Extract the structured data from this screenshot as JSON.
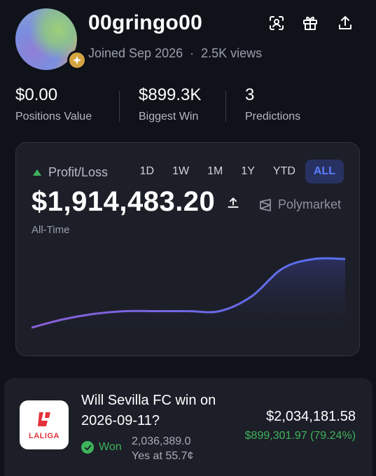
{
  "profile": {
    "username": "00gringo00",
    "joined": "Joined Sep 2026",
    "separator": "·",
    "views": "2.5K views"
  },
  "header_icons": [
    "scan-icon",
    "gift-icon",
    "share-icon"
  ],
  "stats": [
    {
      "value": "$0.00",
      "label": "Positions Value"
    },
    {
      "value": "$899.3K",
      "label": "Biggest Win"
    },
    {
      "value": "3",
      "label": "Predictions"
    }
  ],
  "pnl": {
    "label": "Profit/Loss",
    "ranges": [
      "1D",
      "1W",
      "1M",
      "1Y",
      "YTD",
      "ALL"
    ],
    "active_range": "ALL",
    "value": "$1,914,483.20",
    "period": "All-Time",
    "brand": "Polymarket",
    "colors": {
      "positive": "#3fb35c",
      "accent": "#5b7cff",
      "line": "#6b63e0"
    }
  },
  "chart_data": {
    "type": "area",
    "title": "",
    "xlabel": "",
    "ylabel": "",
    "x": [
      0,
      1,
      2,
      3,
      4,
      5,
      6,
      7,
      8,
      9,
      10
    ],
    "values": [
      0,
      0.12,
      0.2,
      0.24,
      0.24,
      0.24,
      0.24,
      0.45,
      0.86,
      1.0,
      1.0
    ],
    "ylim": [
      0,
      1
    ]
  },
  "market": {
    "logo_text": "LALIGA",
    "question": "Will Sevilla FC win on 2026-09-11?",
    "status": "Won",
    "shares": "2,036,389.0",
    "position": "Yes at 55.7¢",
    "amount": "$2,034,181.58",
    "profit": "$899,301.97 (79.24%)"
  }
}
